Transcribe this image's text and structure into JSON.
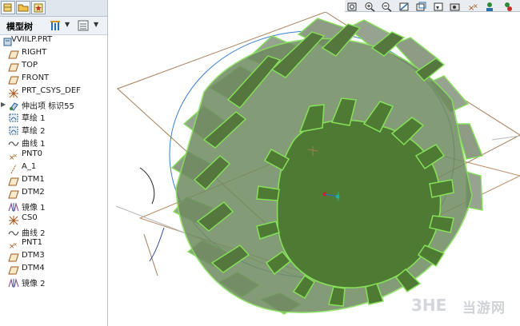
{
  "panel": {
    "title": "模型树"
  },
  "tree": {
    "items": [
      {
        "label": "VVIILP.PRT",
        "icon": "part-icon",
        "expandable": false
      },
      {
        "label": "RIGHT",
        "icon": "datum-plane-icon",
        "expandable": false
      },
      {
        "label": "TOP",
        "icon": "datum-plane-icon",
        "expandable": false
      },
      {
        "label": "FRONT",
        "icon": "datum-plane-icon",
        "expandable": false
      },
      {
        "label": "PRT_CSYS_DEF",
        "icon": "csys-icon",
        "expandable": false
      },
      {
        "label": "伸出项 标识55",
        "icon": "extrude-icon",
        "expandable": true
      },
      {
        "label": "草绘 1",
        "icon": "sketch-icon",
        "expandable": false
      },
      {
        "label": "草绘 2",
        "icon": "sketch-icon",
        "expandable": false
      },
      {
        "label": "曲线 1",
        "icon": "curve-icon",
        "expandable": false
      },
      {
        "label": "PNT0",
        "icon": "datum-point-icon",
        "expandable": false
      },
      {
        "label": "A_1",
        "icon": "datum-axis-icon",
        "expandable": false
      },
      {
        "label": "DTM1",
        "icon": "datum-plane-icon",
        "expandable": false
      },
      {
        "label": "DTM2",
        "icon": "datum-plane-icon",
        "expandable": false
      },
      {
        "label": "镜像 1",
        "icon": "mirror-icon",
        "expandable": false
      },
      {
        "label": "CS0",
        "icon": "csys-icon",
        "expandable": false
      },
      {
        "label": "曲线 2",
        "icon": "curve-icon",
        "expandable": false
      },
      {
        "label": "PNT1",
        "icon": "datum-point-icon",
        "expandable": false
      },
      {
        "label": "DTM3",
        "icon": "datum-plane-icon",
        "expandable": false
      },
      {
        "label": "DTM4",
        "icon": "datum-plane-icon",
        "expandable": false
      },
      {
        "label": "镜像 2",
        "icon": "mirror-icon",
        "expandable": false
      }
    ]
  },
  "toolbar": {
    "buttons": [
      "refit-icon",
      "zoom-in-icon",
      "zoom-out-icon",
      "repaint-icon",
      "orient-icon",
      "saved-views-icon",
      "spin-center-icon",
      "datum-display-icon",
      "appearance-icon",
      "settings-icon"
    ]
  },
  "watermark": {
    "text": "当游网"
  },
  "colors": {
    "gear_fill": "#4e7a34",
    "gear_edge": "#86e05a",
    "gear_side": "#8f9d8c",
    "panel_bg": "#ffffff",
    "header_bg": "#eef2f6"
  }
}
